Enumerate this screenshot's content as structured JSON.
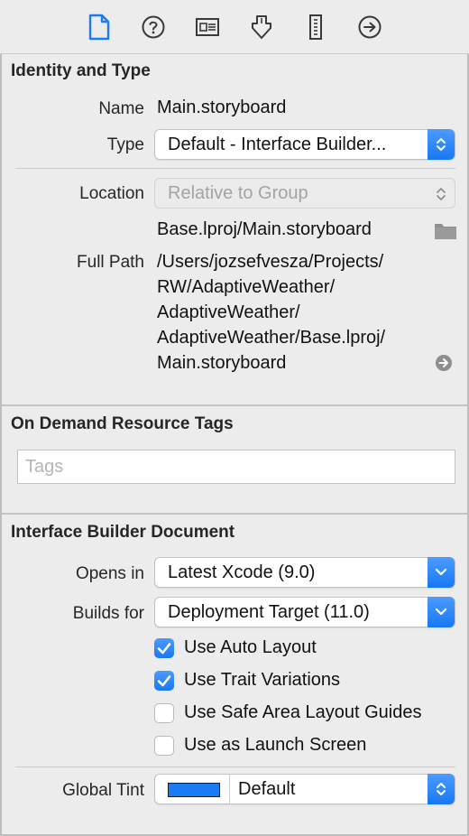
{
  "identity": {
    "title": "Identity and Type",
    "name_label": "Name",
    "name_value": "Main.storyboard",
    "type_label": "Type",
    "type_value": "Default - Interface Builder...",
    "location_label": "Location",
    "location_value": "Relative to Group",
    "location_path": "Base.lproj/Main.storyboard",
    "full_path_label": "Full Path",
    "full_path_lines": [
      "/Users/jozsefvesza/Projects/",
      "RW/AdaptiveWeather/",
      "AdaptiveWeather/",
      "AdaptiveWeather/Base.lproj/",
      "Main.storyboard"
    ]
  },
  "tags": {
    "title": "On Demand Resource Tags",
    "placeholder": "Tags"
  },
  "ib_document": {
    "title": "Interface Builder Document",
    "opens_in_label": "Opens in",
    "opens_in_value": "Latest Xcode (9.0)",
    "builds_for_label": "Builds for",
    "builds_for_value": "Deployment Target (11.0)",
    "checkboxes": [
      {
        "label": "Use Auto Layout",
        "checked": true
      },
      {
        "label": "Use Trait Variations",
        "checked": true
      },
      {
        "label": "Use Safe Area Layout Guides",
        "checked": false
      },
      {
        "label": "Use as Launch Screen",
        "checked": false
      }
    ],
    "global_tint_label": "Global Tint",
    "global_tint_value": "Default",
    "tint_color": "#1a7cf5"
  },
  "colors": {
    "accent": "#1778f2",
    "active_tab_icon": "#1c7cf4",
    "inactive_tab_icon": "#3a3a3a"
  },
  "toolbar_icons": [
    "file-inspector-icon",
    "quick-help-icon",
    "identity-inspector-icon",
    "attributes-inspector-icon",
    "size-inspector-icon",
    "connections-inspector-icon"
  ]
}
